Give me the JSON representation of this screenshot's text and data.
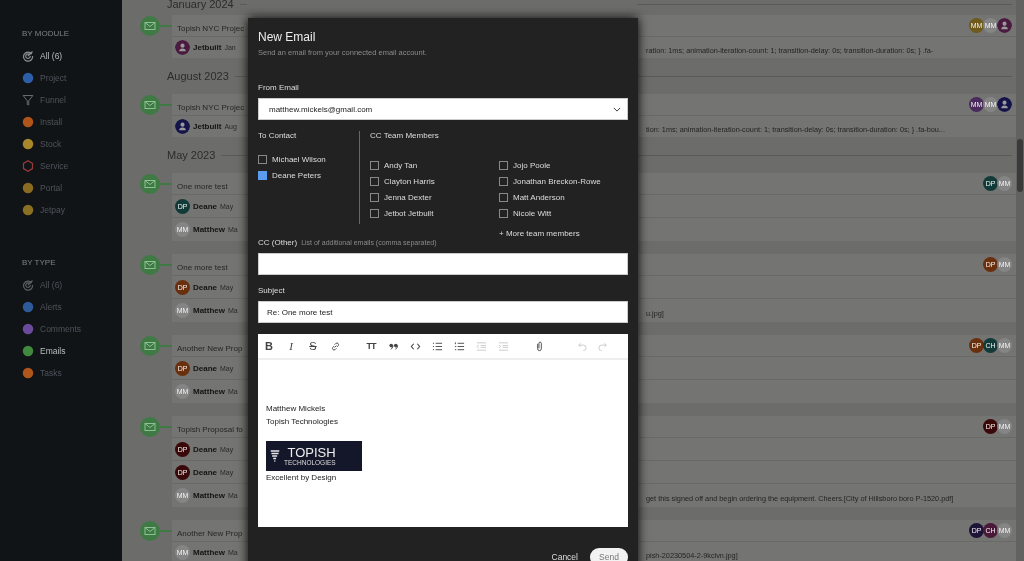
{
  "sidebar": {
    "sections": [
      {
        "heading": "BY MODULE",
        "items": [
          {
            "label": "All (6)",
            "kind": "target",
            "color": "#8a8e93",
            "selected": true
          },
          {
            "label": "Project",
            "kind": "disc",
            "color": "#2d5fa8",
            "selected": false
          },
          {
            "label": "Funnel",
            "kind": "funnel",
            "color": "#6a6e74",
            "selected": false
          },
          {
            "label": "Install",
            "kind": "disc",
            "color": "#b0541a",
            "selected": false
          },
          {
            "label": "Stock",
            "kind": "disc",
            "color": "#a8882a",
            "selected": false
          },
          {
            "label": "Service",
            "kind": "hexagon",
            "color": "#9a3a3a",
            "selected": false
          },
          {
            "label": "Portal",
            "kind": "disc",
            "color": "#8a6a20",
            "selected": false
          },
          {
            "label": "Jetpay",
            "kind": "disc",
            "color": "#8a7020",
            "selected": false
          }
        ]
      },
      {
        "heading": "BY TYPE",
        "items": [
          {
            "label": "All (6)",
            "kind": "target",
            "color": "#5a5e63",
            "selected": false
          },
          {
            "label": "Alerts",
            "kind": "disc",
            "color": "#2f5a9a",
            "selected": false
          },
          {
            "label": "Comments",
            "kind": "disc",
            "color": "#6a4a9a",
            "selected": false
          },
          {
            "label": "Emails",
            "kind": "disc",
            "color": "#3f8a3f",
            "selected": true
          },
          {
            "label": "Tasks",
            "kind": "disc",
            "color": "#b0561a",
            "selected": false
          }
        ]
      }
    ]
  },
  "timeline": [
    {
      "kind": "month",
      "label": "January 2024"
    },
    {
      "kind": "email",
      "title": "Topish NYC Projec",
      "avatars": [
        {
          "initials": "MM",
          "color": "#6e5a1a"
        },
        {
          "initials": "MM",
          "color": "#858585"
        },
        {
          "kind": "person",
          "color": "#4a1a40"
        }
      ],
      "rows": [
        {
          "avatar": {
            "kind": "person",
            "color": "#4a1a40"
          },
          "name": "Jetbuilt",
          "date": "Jan",
          "preview": "ration: 1ms; animation-iteration-count: 1; transition-delay: 0s; transition-duration: 0s; } .fa-"
        }
      ]
    },
    {
      "kind": "month",
      "label": "August 2023"
    },
    {
      "kind": "email",
      "title": "Topish NYC Projec",
      "avatars": [
        {
          "initials": "MM",
          "color": "#4a2a5a"
        },
        {
          "initials": "MM",
          "color": "#858585"
        },
        {
          "kind": "person",
          "color": "#14144a"
        }
      ],
      "rows": [
        {
          "avatar": {
            "kind": "person",
            "color": "#14144a"
          },
          "name": "Jetbuilt",
          "date": "Aug",
          "preview": "tion: 1ms; animation-iteration-count: 1; transition-delay: 0s; transition-duration: 0s; } .fa-bou..."
        }
      ]
    },
    {
      "kind": "month",
      "label": "May 2023"
    },
    {
      "kind": "email",
      "title": "One more test",
      "avatars": [
        {
          "initials": "DP",
          "color": "#123a38"
        },
        {
          "initials": "MM",
          "color": "#858585"
        }
      ],
      "rows": [
        {
          "avatar": {
            "initials": "DP",
            "color": "#123a38"
          },
          "name": "Deane",
          "date": "May"
        },
        {
          "avatar": {
            "initials": "MM",
            "color": "#858585"
          },
          "name": "Matthew",
          "date": "Ma"
        }
      ]
    },
    {
      "kind": "email",
      "title": "One more test",
      "avatars": [
        {
          "initials": "DP",
          "color": "#6a300e"
        },
        {
          "initials": "MM",
          "color": "#858585"
        }
      ],
      "rows": [
        {
          "avatar": {
            "initials": "DP",
            "color": "#6a300e"
          },
          "name": "Deane",
          "date": "May"
        },
        {
          "avatar": {
            "initials": "MM",
            "color": "#858585"
          },
          "name": "Matthew",
          "date": "Ma",
          "preview": "u.jpg]"
        }
      ]
    },
    {
      "kind": "email",
      "title": "Another New Prop",
      "avatars": [
        {
          "initials": "DP",
          "color": "#6a300e"
        },
        {
          "initials": "CH",
          "color": "#123a38"
        },
        {
          "initials": "MM",
          "color": "#858585"
        }
      ],
      "rows": [
        {
          "avatar": {
            "initials": "DP",
            "color": "#6a300e"
          },
          "name": "Deane",
          "date": "May"
        },
        {
          "avatar": {
            "initials": "MM",
            "color": "#858585"
          },
          "name": "Matthew",
          "date": "Ma"
        }
      ]
    },
    {
      "kind": "email",
      "title": "Topish Proposal fo",
      "avatars": [
        {
          "initials": "DP",
          "color": "#3a0808"
        },
        {
          "initials": "MM",
          "color": "#858585"
        }
      ],
      "rows": [
        {
          "avatar": {
            "initials": "DP",
            "color": "#3a0808"
          },
          "name": "Deane",
          "date": "May"
        },
        {
          "avatar": {
            "initials": "DP",
            "color": "#3a0808"
          },
          "name": "Deane",
          "date": "May"
        },
        {
          "avatar": {
            "initials": "MM",
            "color": "#858585"
          },
          "name": "Matthew",
          "date": "Ma",
          "preview": "get this signed off and begin ordering the equipment. Cheers.[City of Hillsboro boro P-1520.pdf]"
        }
      ]
    },
    {
      "kind": "email",
      "title": "Another New Prop",
      "avatars": [
        {
          "initials": "DP",
          "color": "#1e1438"
        },
        {
          "initials": "CH",
          "color": "#4a1838"
        },
        {
          "initials": "MM",
          "color": "#858585"
        }
      ],
      "rows": [
        {
          "avatar": {
            "initials": "MM",
            "color": "#858585"
          },
          "name": "Matthew",
          "date": "Ma",
          "preview": "pish-20230504-2-9kcivn.jpg]"
        }
      ]
    }
  ],
  "modal": {
    "title": "New Email",
    "subtitle": "Send an email from your connected email account.",
    "from_label": "From Email",
    "from_value": "matthew.mickels@gmail.com",
    "to_label": "To Contact",
    "contacts": [
      {
        "name": "Michael Wilson",
        "checked": false
      },
      {
        "name": "Deane Peters",
        "checked": true
      }
    ],
    "team_label": "CC Team Members",
    "team": [
      {
        "name": "Andy Tan",
        "checked": false
      },
      {
        "name": "Clayton Harris",
        "checked": false
      },
      {
        "name": "Jenna Dexter",
        "checked": false
      },
      {
        "name": "Jetbot Jetbuilt",
        "checked": false
      },
      {
        "name": "Jojo Poole",
        "checked": false
      },
      {
        "name": "Jonathan Breckon-Rowe",
        "checked": false
      },
      {
        "name": "Matt Anderson",
        "checked": false
      },
      {
        "name": "Nicole Witt",
        "checked": false
      }
    ],
    "more_link": "+ More team members",
    "cc_label": "CC (Other)",
    "cc_hint": "List of additional emails (comma separated)",
    "subject_label": "Subject",
    "subject_value": "Re: One more test",
    "toolbar": [
      {
        "kind": "bold",
        "glyph": "B",
        "disabled": false,
        "separated": false
      },
      {
        "kind": "italic",
        "glyph": "I",
        "disabled": false,
        "separated": false
      },
      {
        "kind": "strike",
        "glyph": "S",
        "disabled": false,
        "separated": false
      },
      {
        "kind": "link",
        "disabled": false,
        "separated": false
      },
      {
        "kind": "textsize",
        "glyph": "TT",
        "disabled": false,
        "separated": true
      },
      {
        "kind": "quote",
        "disabled": false,
        "separated": false
      },
      {
        "kind": "code",
        "disabled": false,
        "separated": false
      },
      {
        "kind": "bullets",
        "disabled": false,
        "separated": false
      },
      {
        "kind": "numbers",
        "disabled": false,
        "separated": false
      },
      {
        "kind": "outdent",
        "disabled": true,
        "separated": false
      },
      {
        "kind": "indent",
        "disabled": true,
        "separated": false
      },
      {
        "kind": "attach",
        "disabled": false,
        "separated": true
      },
      {
        "kind": "undo",
        "disabled": true,
        "separated": true
      },
      {
        "kind": "redo",
        "disabled": true,
        "separated": false
      }
    ],
    "signature": {
      "lines": [
        "Matthew Mickels",
        "Topish Technologies"
      ],
      "logo": {
        "name": "TOPISH",
        "tagline": "TECHNOLOGIES"
      },
      "closing": "Excellent by Design"
    },
    "buttons": {
      "cancel": "Cancel",
      "send": "Send"
    }
  }
}
